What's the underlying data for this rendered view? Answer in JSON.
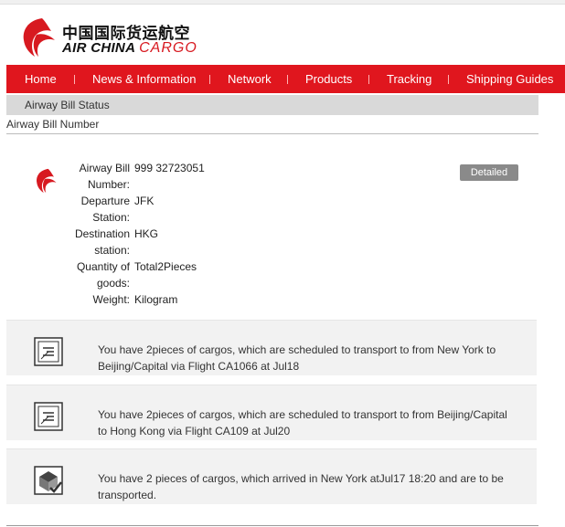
{
  "brand": {
    "chinese_name": "中国国际货运航空",
    "english_name_1": "AIR CHINA",
    "english_name_2": "CARGO",
    "logo_icon": "phoenix-logo",
    "accent_color": "#e0161e"
  },
  "nav": {
    "items": [
      {
        "label": "Home"
      },
      {
        "label": "News & Information"
      },
      {
        "label": "Network"
      },
      {
        "label": "Products"
      },
      {
        "label": "Tracking"
      },
      {
        "label": "Shipping Guides"
      }
    ]
  },
  "section": {
    "title": "Airway Bill Status",
    "subtitle": "Airway Bill Number"
  },
  "awb": {
    "rows": [
      {
        "label_1": "Airway Bill",
        "label_2": "Number:",
        "value": "999 32723051"
      },
      {
        "label_1": "Departure",
        "label_2": "Station:",
        "value": "JFK"
      },
      {
        "label_1": "Destination",
        "label_2": "station:",
        "value": "HKG"
      },
      {
        "label_1": "Quantity of",
        "label_2": "goods:",
        "value": "Total2Pieces"
      },
      {
        "label_1": "Weight:",
        "label_2": "",
        "value": "Kilogram"
      }
    ],
    "detailed_button": "Detailed"
  },
  "events": [
    {
      "icon": "flight-plan-icon",
      "text": "You have 2pieces of cargos, which are scheduled to transport to from New York to Beijing/Capital via Flight CA1066 at Jul18"
    },
    {
      "icon": "flight-plan-icon",
      "text": "You have 2pieces of cargos, which are scheduled to transport to from Beijing/Capital to Hong Kong via Flight CA109 at Jul20"
    },
    {
      "icon": "cargo-arrived-icon",
      "text": "You have 2 pieces of cargos, which arrived in New York atJul17 18:20 and are to be transported."
    }
  ]
}
